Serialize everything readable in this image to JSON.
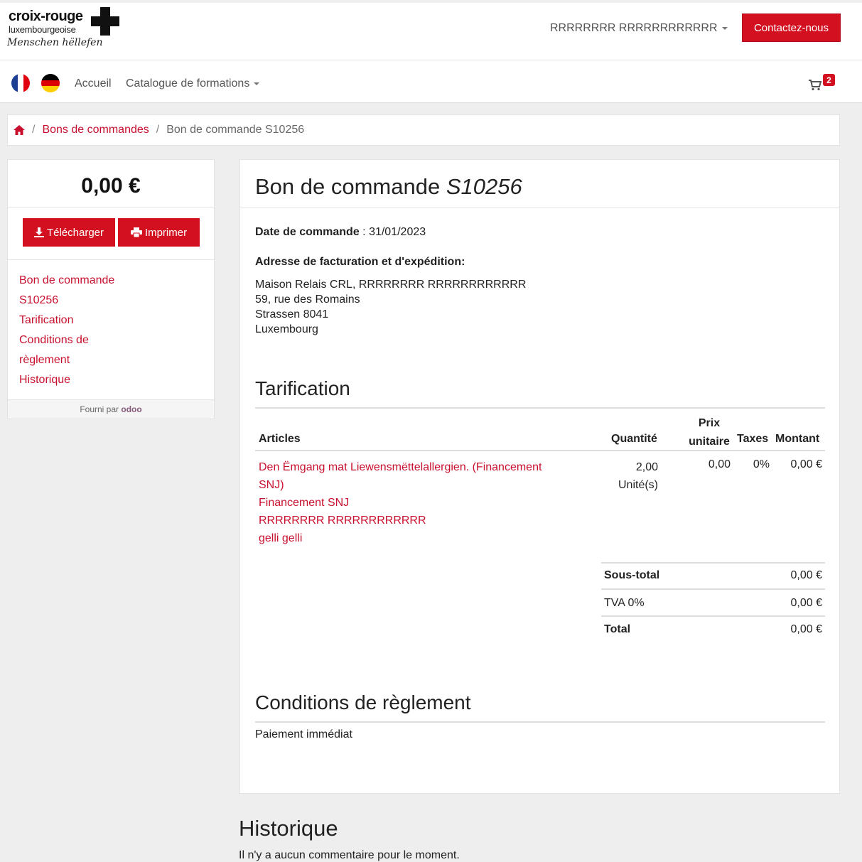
{
  "logo": {
    "line1": "croix-rouge",
    "line2": "luxembourgeoise",
    "line3": "Menschen hëllefen"
  },
  "header": {
    "user_name": "RRRRRRRR RRRRRRRRRRRR",
    "contact_label": "Contactez-nous",
    "nav_home": "Accueil",
    "nav_catalog": "Catalogue de formations",
    "cart_count": "2"
  },
  "breadcrumb": {
    "orders_link": "Bons de commandes",
    "separator": "/",
    "current": "Bon de commande S10256"
  },
  "sidebar": {
    "amount": "0,00 €",
    "download_label": "Télécharger",
    "print_label": "Imprimer",
    "nav": [
      "Bon de commande",
      "S10256",
      "Tarification",
      "Conditions de",
      "règlement",
      "Historique"
    ],
    "footer_prefix": "Fourni par",
    "footer_brand": "odoo"
  },
  "order": {
    "title_prefix": "Bon de commande",
    "title_ref": "S10256",
    "date_label": "Date de commande",
    "date_sep": " : ",
    "date_value": "31/01/2023",
    "address_label": "Adresse de facturation et d'expédition:",
    "address_lines": [
      "Maison Relais CRL, RRRRRRRR RRRRRRRRRRRR",
      "59, rue des Romains",
      "Strassen 8041",
      "Luxembourg"
    ]
  },
  "pricing": {
    "title": "Tarification",
    "headers": {
      "articles": "Articles",
      "quantity": "Quantité",
      "unit_price_1": "Prix",
      "unit_price_2": "unitaire",
      "taxes": "Taxes",
      "amount": "Montant"
    },
    "product_lines": [
      "Den Ëmgang mat Liewensmëttelallergien. (Financement",
      "SNJ)",
      "Financement SNJ",
      "RRRRRRRR RRRRRRRRRRRR",
      "gelli gelli"
    ],
    "quantity": "2,00",
    "unit": "Unité(s)",
    "unit_price": "0,00",
    "tax": "0%",
    "amount": "0,00 €",
    "subtotal_label": "Sous-total",
    "subtotal_value": "0,00 €",
    "vat_label": "TVA 0%",
    "vat_value": "0,00 €",
    "total_label": "Total",
    "total_value": "0,00 €"
  },
  "conditions": {
    "title": "Conditions de règlement",
    "text": "Paiement immédiat"
  },
  "history": {
    "title": "Historique",
    "text": "Il n'y a aucun commentaire pour le moment."
  },
  "colors": {
    "accent": "#d3101f",
    "link": "#c8102e"
  }
}
